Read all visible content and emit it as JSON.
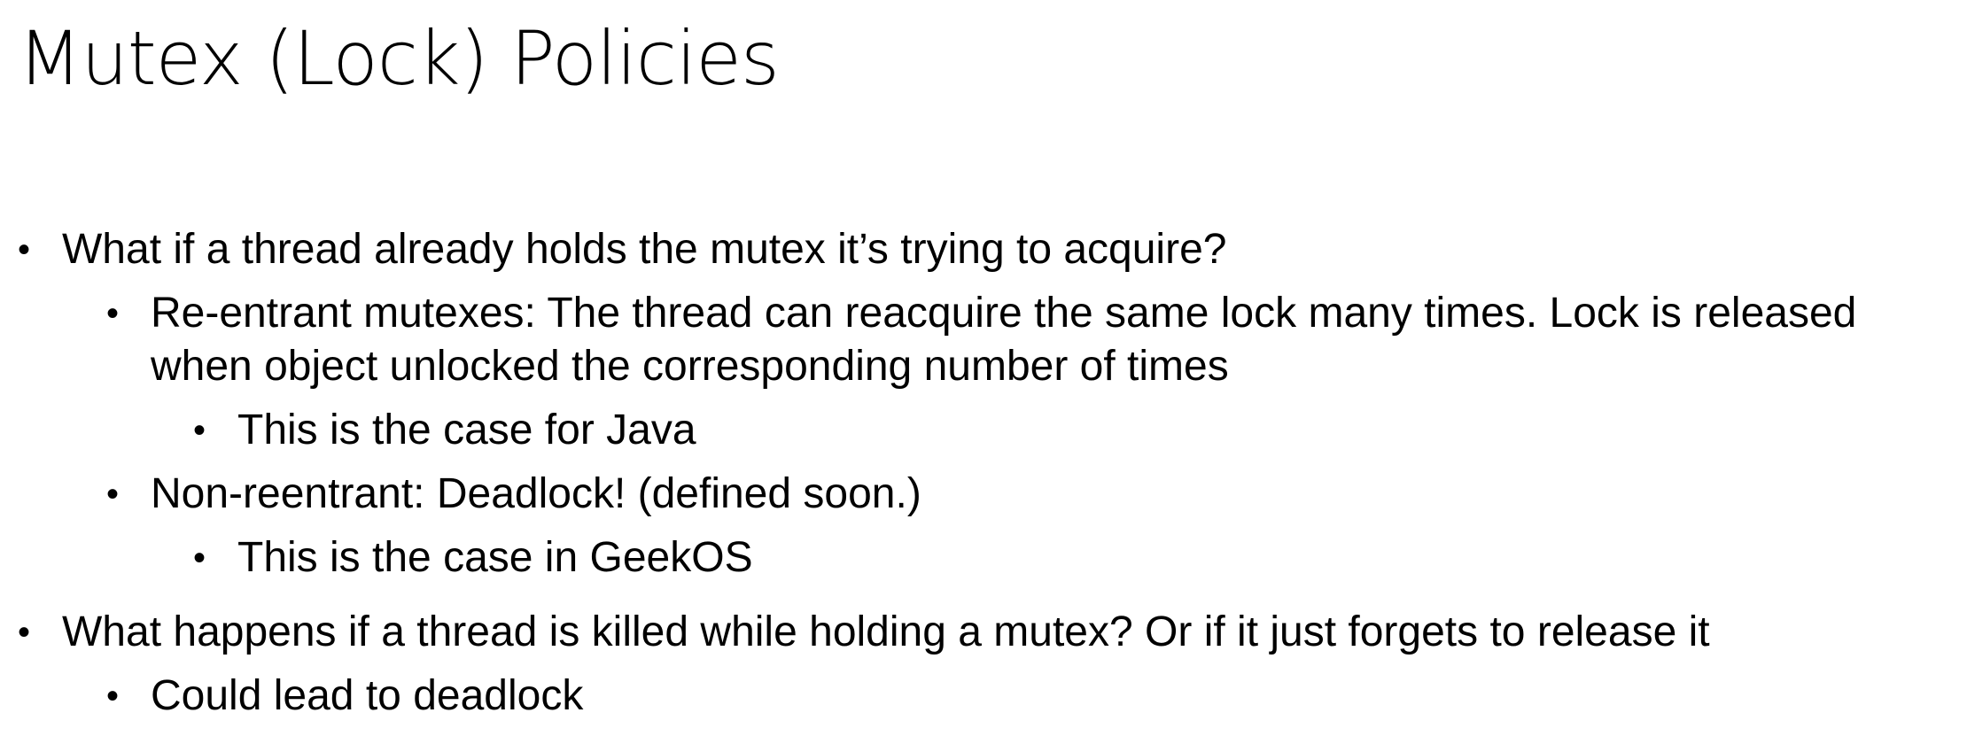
{
  "slide": {
    "title": "Mutex (Lock) Policies",
    "bullet_glyph": "•",
    "bullets": [
      {
        "level": 1,
        "text": "What if a thread already holds the mutex it’s trying to acquire?"
      },
      {
        "level": 2,
        "line1": "Re-entrant  mutexes: The thread can reacquire the same lock many times.  Lock is released",
        "line2": "when object unlocked the corresponding number of times"
      },
      {
        "level": 3,
        "text": "This is the case for Java"
      },
      {
        "level": 2,
        "text": "Non-reentrant: Deadlock! (defined soon.)"
      },
      {
        "level": 3,
        "text": "This is the case in GeekOS"
      },
      {
        "level": 1,
        "text": "What happens if a thread is killed while holding a mutex?  Or if it just forgets to release it"
      },
      {
        "level": 2,
        "text": "Could lead to deadlock"
      }
    ]
  }
}
